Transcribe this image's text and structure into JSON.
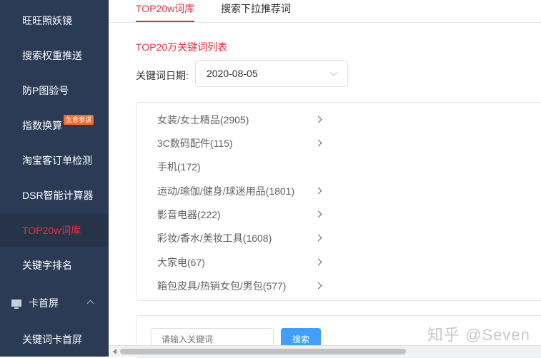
{
  "sidebar": {
    "items": [
      {
        "label": "旺旺照妖镜"
      },
      {
        "label": "搜索权重推送"
      },
      {
        "label": "防P图验号"
      },
      {
        "label": "指数换算",
        "badge": "生意参谋"
      },
      {
        "label": "淘宝客订单检测"
      },
      {
        "label": "DSR智能计算器"
      },
      {
        "label": "TOP20w词库"
      },
      {
        "label": "关键字排名"
      }
    ],
    "group": {
      "label": "卡首屏",
      "icon": "monitor-icon"
    },
    "sub_item": {
      "label": "关键词卡首屏"
    }
  },
  "tabs": [
    "TOP20w词库",
    "搜索下拉推荐词"
  ],
  "section_title": "TOP20万关键词列表",
  "date_filter": {
    "label": "关键词日期:",
    "value": "2020-08-05"
  },
  "categories": [
    {
      "label": "女装/女士精品(2905)"
    },
    {
      "label": "3C数码配件(115)"
    },
    {
      "label": "手机(172)"
    },
    {
      "label": "运动/瑜伽/健身/球迷用品(1801)"
    },
    {
      "label": "影音电器(222)"
    },
    {
      "label": "彩妆/香水/美妆工具(1608)"
    },
    {
      "label": "大家电(67)"
    },
    {
      "label": "箱包皮具/热销女包/男包(577)"
    }
  ],
  "search": {
    "placeholder": "请输入关键词",
    "button": "搜索"
  },
  "watermark": "知乎 @Seven",
  "colors": {
    "accent": "#e0303f",
    "sidebar_bg": "#2b3a55",
    "button": "#409eff"
  }
}
